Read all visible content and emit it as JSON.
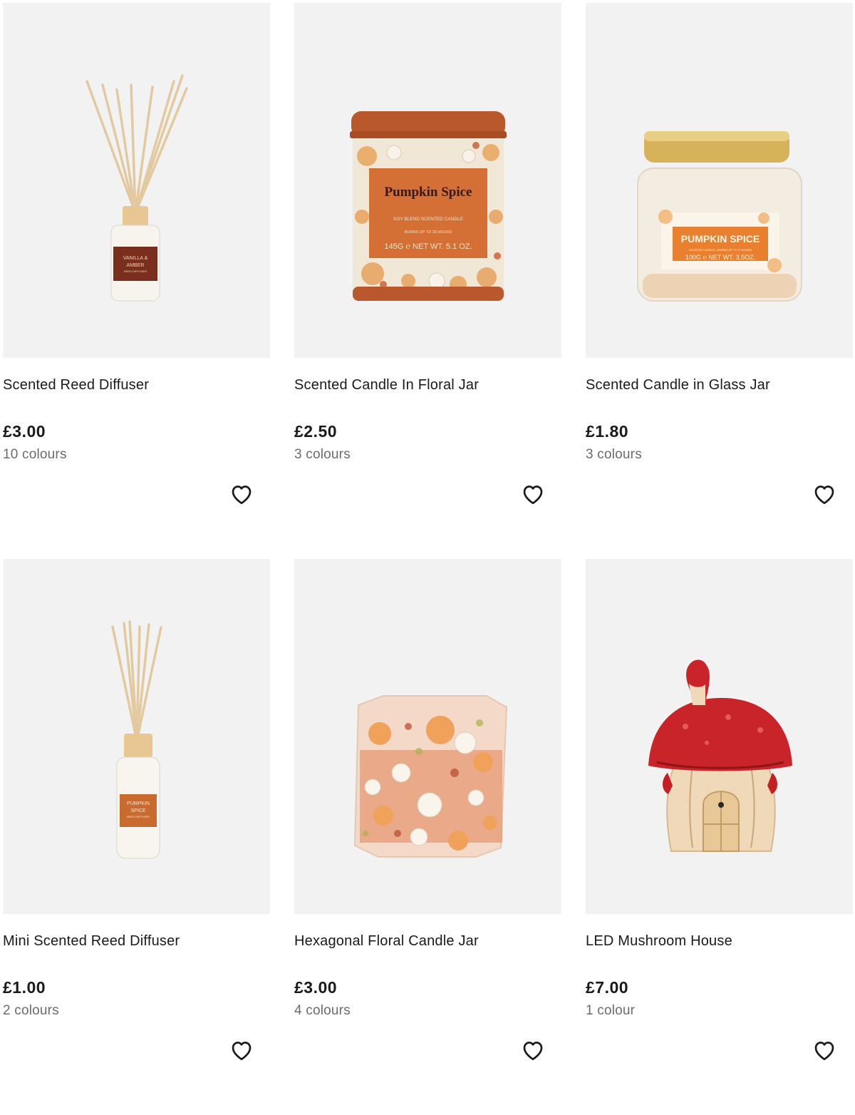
{
  "products": [
    {
      "name": "Scented Reed Diffuser",
      "price": "£3.00",
      "colours": "10 colours",
      "image": "reed-diffuser-vanilla-amber",
      "label_lines": [
        "VANILLA &",
        "AMBER",
        "REED DIFFUSER"
      ]
    },
    {
      "name": "Scented Candle In Floral Jar",
      "price": "£2.50",
      "colours": "3 colours",
      "image": "pumpkin-spice-tin-candle",
      "label_lines": [
        "Pumpkin Spice",
        "SOY BLEND SCENTED CANDLE",
        "BURNS UP TO 30 HOURS",
        "145G ℮ NET WT. 5.1 OZ."
      ]
    },
    {
      "name": "Scented Candle in Glass Jar",
      "price": "£1.80",
      "colours": "3 colours",
      "image": "pumpkin-spice-glass-jar-candle",
      "label_lines": [
        "PUMPKIN SPICE",
        "SCENTED CANDLE | BURNS UP TO 17 HOURS",
        "100G ℮ NET WT. 3.5OZ."
      ]
    },
    {
      "name": "Mini Scented Reed Diffuser",
      "price": "£1.00",
      "colours": "2 colours",
      "image": "mini-reed-diffuser-pumpkin-spice",
      "label_lines": [
        "PUMPKIN",
        "SPICE",
        "REED DIFFUSER"
      ]
    },
    {
      "name": "Hexagonal Floral Candle Jar",
      "price": "£3.00",
      "colours": "4 colours",
      "image": "hexagonal-floral-candle"
    },
    {
      "name": "LED Mushroom House",
      "price": "£7.00",
      "colours": "1 colour",
      "image": "led-mushroom-house"
    }
  ],
  "favourite_icon": "heart-outline-icon",
  "colors": {
    "image_bg": "#f2f2f2",
    "text": "#1a1a1a",
    "muted": "#6b6b6b"
  }
}
